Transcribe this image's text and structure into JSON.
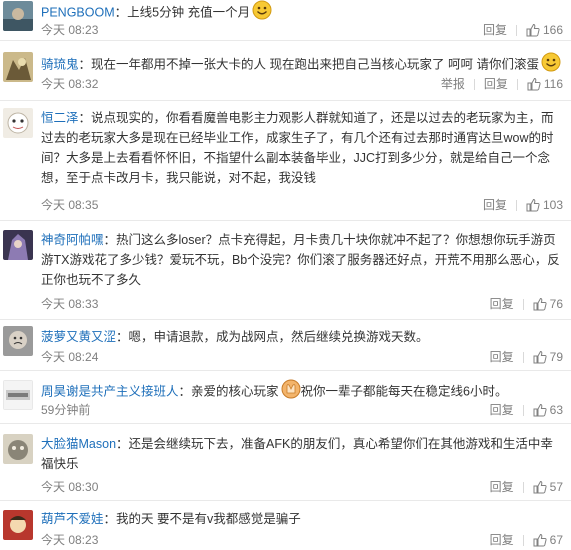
{
  "labels": {
    "report": "举报",
    "reply": "回复"
  },
  "colors": {
    "name_orange": "#eb7350",
    "name_blue": "#1e6fba",
    "meta_gray": "#808080"
  },
  "comments": [
    {
      "user": "PENGBOOM",
      "text": "上线5分钟 充值一个月",
      "emoji": "smile",
      "time": "今天 08:23",
      "likes": "166",
      "show_report": false
    },
    {
      "user": "骑琉鬼",
      "text": "现在一年都用不掉一张大卡的人 现在跑出来把自己当核心玩家了 呵呵 请你们滚蛋",
      "emoji": "smile",
      "time": "今天 08:32",
      "likes": "116",
      "show_report": true
    },
    {
      "user": "恒二泽",
      "text": "说点现实的，你看看魔兽电影主力观影人群就知道了，还是以过去的老玩家为主，而过去的老玩家大多是现在已经毕业工作，成家生子了，有几个还有过去那时通宵达旦wow的时间？大多是上去看看怀怀旧，不指望什么副本装备毕业，JJC打到多少分，就是给自己一个念想，至于点卡改月卡，我只能说，对不起，我没钱",
      "emoji": "",
      "time": "今天 08:35",
      "likes": "103",
      "show_report": false
    },
    {
      "user": "神奇阿帕嘿",
      "text": "热门这么多loser？点卡充得起，月卡贵几十块你就冲不起了？你想想你玩手游页游TX游戏花了多少钱？爱玩不玩，Bb个没完？你们滚了服务器还好点，开荒不用那么恶心，反正你也玩不了多久",
      "emoji": "",
      "time": "今天 08:33",
      "likes": "76",
      "show_report": false
    },
    {
      "user": "菠萝又黄又涩",
      "text": "嗯，申请退款，成为战网点，然后继续兑换游戏天数。",
      "emoji": "",
      "time": "今天 08:24",
      "likes": "79",
      "show_report": false
    },
    {
      "user": "周昊谢是共产主义接班人",
      "text": "亲爱的核心玩家",
      "text2": "祝你一辈子都能每天在稳定线6小时。",
      "emoji": "hands",
      "time": "59分钟前",
      "likes": "63",
      "show_report": false
    },
    {
      "user": "大脸猫Mason",
      "text": "还是会继续玩下去，准备AFK的朋友们，真心希望你们在其他游戏和生活中幸福快乐",
      "emoji": "",
      "time": "今天 08:30",
      "likes": "57",
      "show_report": false
    },
    {
      "user": "葫芦不爱娃",
      "text": "我的天 要不是有v我都感觉是骗子",
      "emoji": "",
      "time": "今天 08:23",
      "likes": "67",
      "show_report": false
    }
  ]
}
